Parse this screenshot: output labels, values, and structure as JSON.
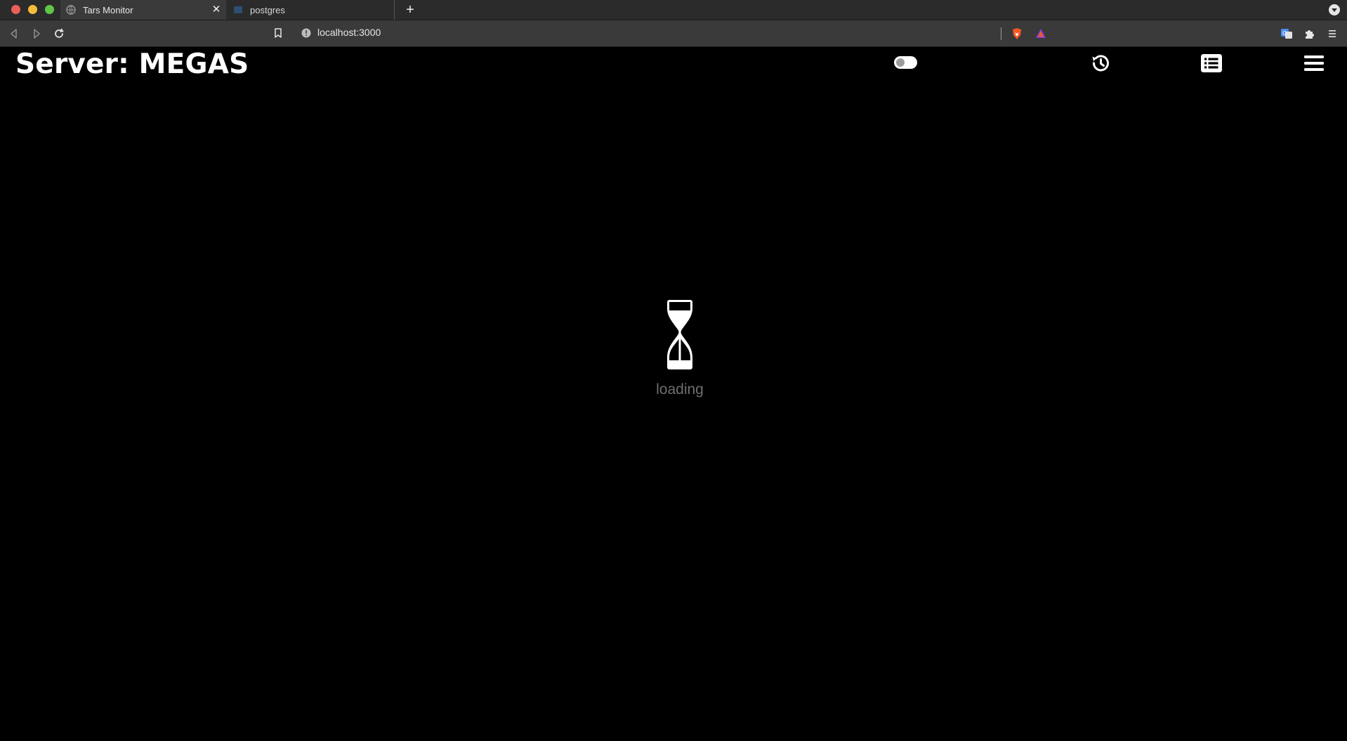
{
  "browser": {
    "tabs": [
      {
        "title": "Tars Monitor",
        "active": true
      },
      {
        "title": "postgres",
        "active": false
      }
    ],
    "address": "localhost:3000"
  },
  "header": {
    "title": "Server: MEGAS",
    "theme_toggle_on": false
  },
  "icons": {
    "history": "history-icon",
    "list": "list-icon",
    "menu": "hamburger-menu-icon",
    "loader": "hourglass-icon"
  },
  "status": {
    "loading_text": "loading"
  },
  "colors": {
    "page_background": "#000000",
    "tab_strip": "#2b2b2b",
    "toolbar": "#3a3a3a",
    "loading_text": "#6e6e6e"
  }
}
